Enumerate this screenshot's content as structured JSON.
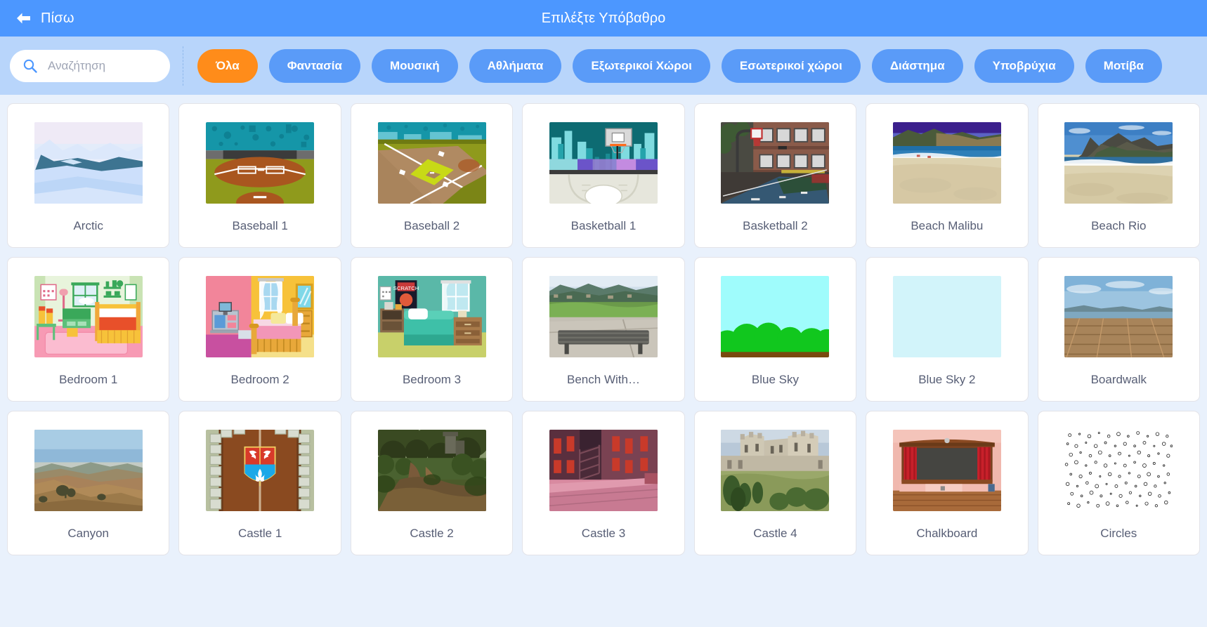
{
  "header": {
    "back_label": "Πίσω",
    "back_icon": "arrow-left-icon",
    "title": "Επιλέξτε Υπόβαθρο",
    "bg_color": "#4c97ff"
  },
  "filter_bar": {
    "bg_color": "#b8d5fb",
    "search": {
      "icon": "search-icon",
      "placeholder": "Αναζήτηση",
      "value": ""
    },
    "active_tag": "Όλα",
    "active_color": "#ff8c1a",
    "tag_color": "#5a9bf8",
    "tags": [
      {
        "label": "Όλα",
        "active": true
      },
      {
        "label": "Φαντασία",
        "active": false
      },
      {
        "label": "Μουσική",
        "active": false
      },
      {
        "label": "Αθλήματα",
        "active": false
      },
      {
        "label": "Εξωτερικοί Χώροι",
        "active": false
      },
      {
        "label": "Εσωτερικοί χώροι",
        "active": false
      },
      {
        "label": "Διάστημα",
        "active": false
      },
      {
        "label": "Υποβρύχια",
        "active": false
      },
      {
        "label": "Μοτίβα",
        "active": false
      }
    ]
  },
  "library": {
    "columns": 7,
    "items": [
      {
        "label": "Arctic",
        "art": "arctic"
      },
      {
        "label": "Baseball 1",
        "art": "baseball1"
      },
      {
        "label": "Baseball 2",
        "art": "baseball2"
      },
      {
        "label": "Basketball 1",
        "art": "basketball1"
      },
      {
        "label": "Basketball 2",
        "art": "basketball2"
      },
      {
        "label": "Beach Malibu",
        "art": "beachmalibu"
      },
      {
        "label": "Beach Rio",
        "art": "beachrio"
      },
      {
        "label": "Bedroom 1",
        "art": "bedroom1"
      },
      {
        "label": "Bedroom 2",
        "art": "bedroom2"
      },
      {
        "label": "Bedroom 3",
        "art": "bedroom3"
      },
      {
        "label": "Bench With…",
        "art": "bench"
      },
      {
        "label": "Blue Sky",
        "art": "bluesky"
      },
      {
        "label": "Blue Sky 2",
        "art": "bluesky2"
      },
      {
        "label": "Boardwalk",
        "art": "boardwalk"
      },
      {
        "label": "Canyon",
        "art": "canyon"
      },
      {
        "label": "Castle 1",
        "art": "castle1"
      },
      {
        "label": "Castle 2",
        "art": "castle2"
      },
      {
        "label": "Castle 3",
        "art": "castle3"
      },
      {
        "label": "Castle 4",
        "art": "castle4"
      },
      {
        "label": "Chalkboard",
        "art": "chalkboard"
      },
      {
        "label": "Circles",
        "art": "circles"
      }
    ]
  }
}
